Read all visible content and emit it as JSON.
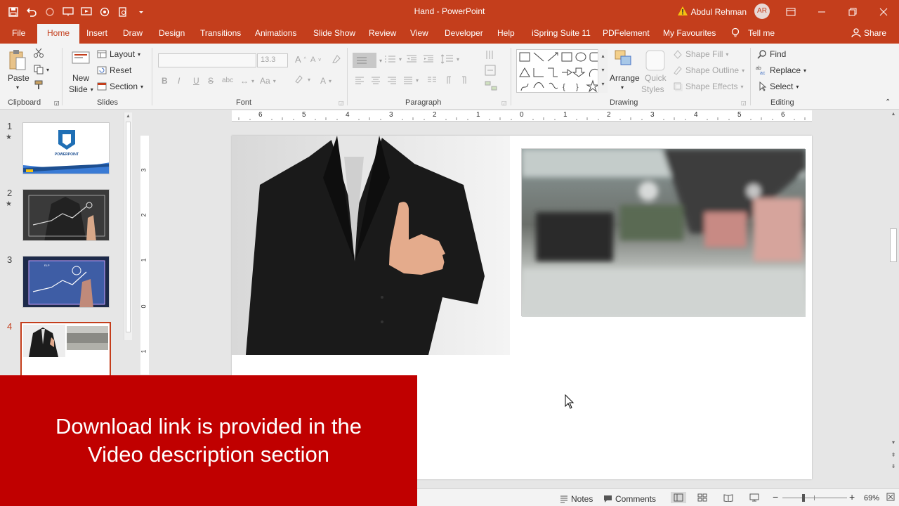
{
  "app": {
    "title": "Hand  -  PowerPoint",
    "user_name": "Abdul Rehman",
    "user_initials": "AR",
    "accent": "#c43e1c"
  },
  "tabs": [
    {
      "label": "File"
    },
    {
      "label": "Home"
    },
    {
      "label": "Insert"
    },
    {
      "label": "Draw"
    },
    {
      "label": "Design"
    },
    {
      "label": "Transitions"
    },
    {
      "label": "Animations"
    },
    {
      "label": "Slide Show"
    },
    {
      "label": "Review"
    },
    {
      "label": "View"
    },
    {
      "label": "Developer"
    },
    {
      "label": "Help"
    },
    {
      "label": "iSpring Suite 11"
    },
    {
      "label": "PDFelement"
    },
    {
      "label": "My Favourites"
    },
    {
      "label": "Tell me"
    },
    {
      "label": "Share"
    }
  ],
  "ribbon": {
    "clipboard": {
      "label": "Clipboard",
      "paste": "Paste"
    },
    "slides": {
      "label": "Slides",
      "new_slide_1": "New",
      "new_slide_2": "Slide",
      "layout": "Layout",
      "reset": "Reset",
      "section": "Section"
    },
    "font": {
      "label": "Font",
      "size": "13.3",
      "bold": "B",
      "italic": "I",
      "underline": "U",
      "strike": "S",
      "shadow": "abc",
      "font_color": "A",
      "grow": "A",
      "shrink": "A"
    },
    "paragraph": {
      "label": "Paragraph"
    },
    "drawing": {
      "label": "Drawing",
      "arrange": "Arrange",
      "quick_1": "Quick",
      "quick_2": "Styles",
      "fill": "Shape Fill",
      "outline": "Shape Outline",
      "effects": "Shape Effects"
    },
    "editing": {
      "label": "Editing",
      "find": "Find",
      "replace": "Replace",
      "select": "Select"
    }
  },
  "ruler": {
    "h_ticks": [
      "6",
      "5",
      "4",
      "3",
      "2",
      "1",
      "0",
      "1",
      "2",
      "3",
      "4",
      "5",
      "6"
    ],
    "v_ticks": [
      "3",
      "2",
      "1",
      "0",
      "1"
    ]
  },
  "thumbnails": [
    {
      "num": "1",
      "star": "★",
      "caption": "POWERPOINT"
    },
    {
      "num": "2",
      "star": "★"
    },
    {
      "num": "3",
      "caption": "ELP"
    },
    {
      "num": "4"
    }
  ],
  "statusbar": {
    "notes": "Notes",
    "comments": "Comments",
    "zoom": "69%"
  },
  "banner": {
    "line1": "Download link is provided in the",
    "line2": "Video description section"
  }
}
